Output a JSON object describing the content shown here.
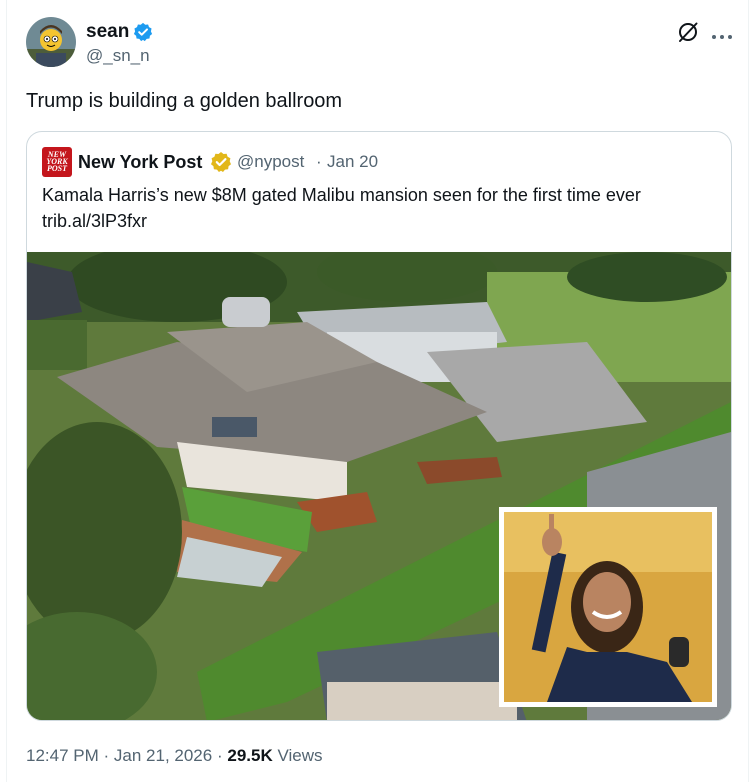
{
  "post": {
    "author": {
      "name": "sean",
      "handle": "@_sn_n",
      "verified": true
    },
    "text": "Trump is building a golden ballroom",
    "quote": {
      "author": {
        "name": "New York Post",
        "handle": "@nypost",
        "verified": true
      },
      "separator": "·",
      "date": "Jan 20",
      "text_line1": "Kamala Harris’s new $8M gated Malibu mansion seen for the first time ever",
      "text_line2": "trib.al/3lP3fxr",
      "logo_line1": "NEW",
      "logo_line2": "YORK",
      "logo_line3": "POST"
    },
    "meta": {
      "time": "12:47 PM",
      "sep1": "·",
      "date": "Jan 21, 2026",
      "sep2": "·",
      "views_count": "29.5K",
      "views_label": "Views"
    }
  },
  "colors": {
    "verified_blue": "#1d9bf0",
    "verified_gold": "#e2b719",
    "nypost_red": "#c4161c",
    "secondary_text": "#536471",
    "border": "#cfd9de"
  },
  "icons": [
    "verified-badge-icon",
    "grok-icon",
    "more-icon"
  ]
}
